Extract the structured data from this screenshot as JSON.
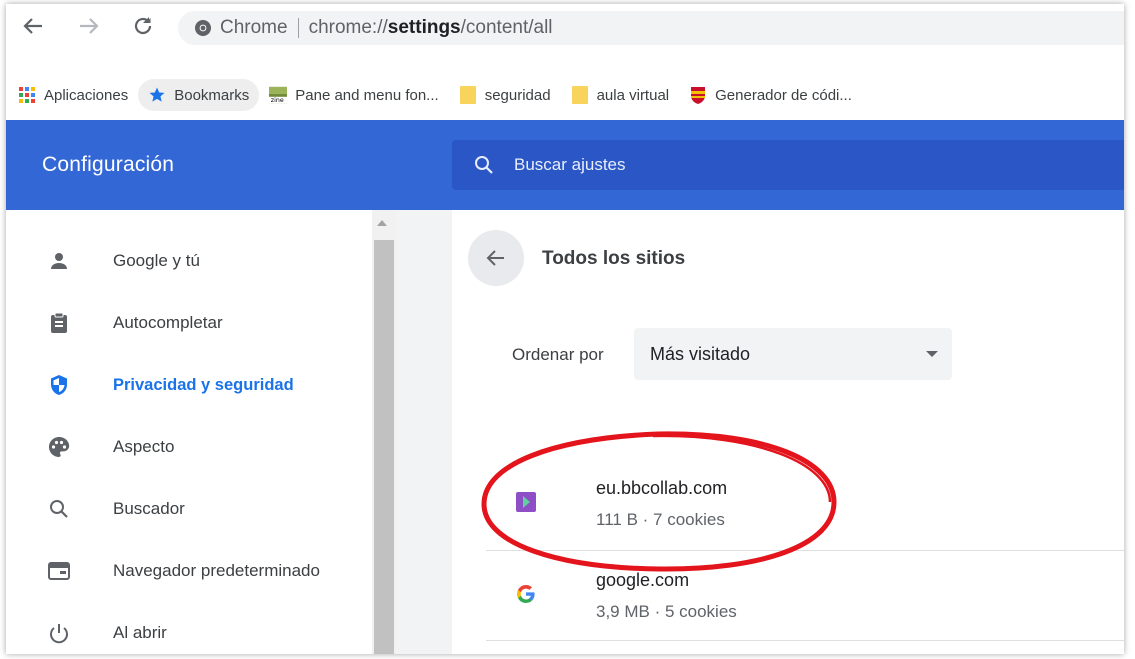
{
  "browser": {
    "tab_site_label": "Chrome",
    "url_prefix": "chrome://",
    "url_bold": "settings",
    "url_suffix": "/content/all"
  },
  "bookmarks": [
    {
      "label": "Aplicaciones",
      "icon": "apps-grid-icon"
    },
    {
      "label": "Bookmarks",
      "icon": "star-icon"
    },
    {
      "label": "Pane and menu fon...",
      "icon": "zine-favicon-icon"
    },
    {
      "label": "seguridad",
      "icon": "folder-icon"
    },
    {
      "label": "aula virtual",
      "icon": "folder-icon"
    },
    {
      "label": "Generador de códi...",
      "icon": "crest-favicon-icon"
    }
  ],
  "header": {
    "title": "Configuración",
    "search_placeholder": "Buscar ajustes"
  },
  "sidebar": {
    "items": [
      {
        "label": "Google y tú",
        "icon": "person-icon",
        "active": false
      },
      {
        "label": "Autocompletar",
        "icon": "clipboard-icon",
        "active": false
      },
      {
        "label": "Privacidad y seguridad",
        "icon": "shield-icon",
        "active": true
      },
      {
        "label": "Aspecto",
        "icon": "palette-icon",
        "active": false
      },
      {
        "label": "Buscador",
        "icon": "search-icon",
        "active": false
      },
      {
        "label": "Navegador predeterminado",
        "icon": "browser-window-icon",
        "active": false
      },
      {
        "label": "Al abrir",
        "icon": "power-icon",
        "active": false
      }
    ]
  },
  "main": {
    "title": "Todos los sitios",
    "sort_label": "Ordenar por",
    "sort_value": "Más visitado",
    "sites": [
      {
        "domain": "eu.bbcollab.com",
        "detail": "111 B · 7 cookies",
        "icon": "bbcollab-favicon-icon"
      },
      {
        "domain": "google.com",
        "detail": "3,9 MB · 5 cookies",
        "icon": "google-g-icon"
      }
    ]
  },
  "colors": {
    "header_blue": "#3367d6",
    "search_blue": "#2a56c6",
    "active_blue": "#1a73e8",
    "annotation_red": "#e3141b"
  }
}
